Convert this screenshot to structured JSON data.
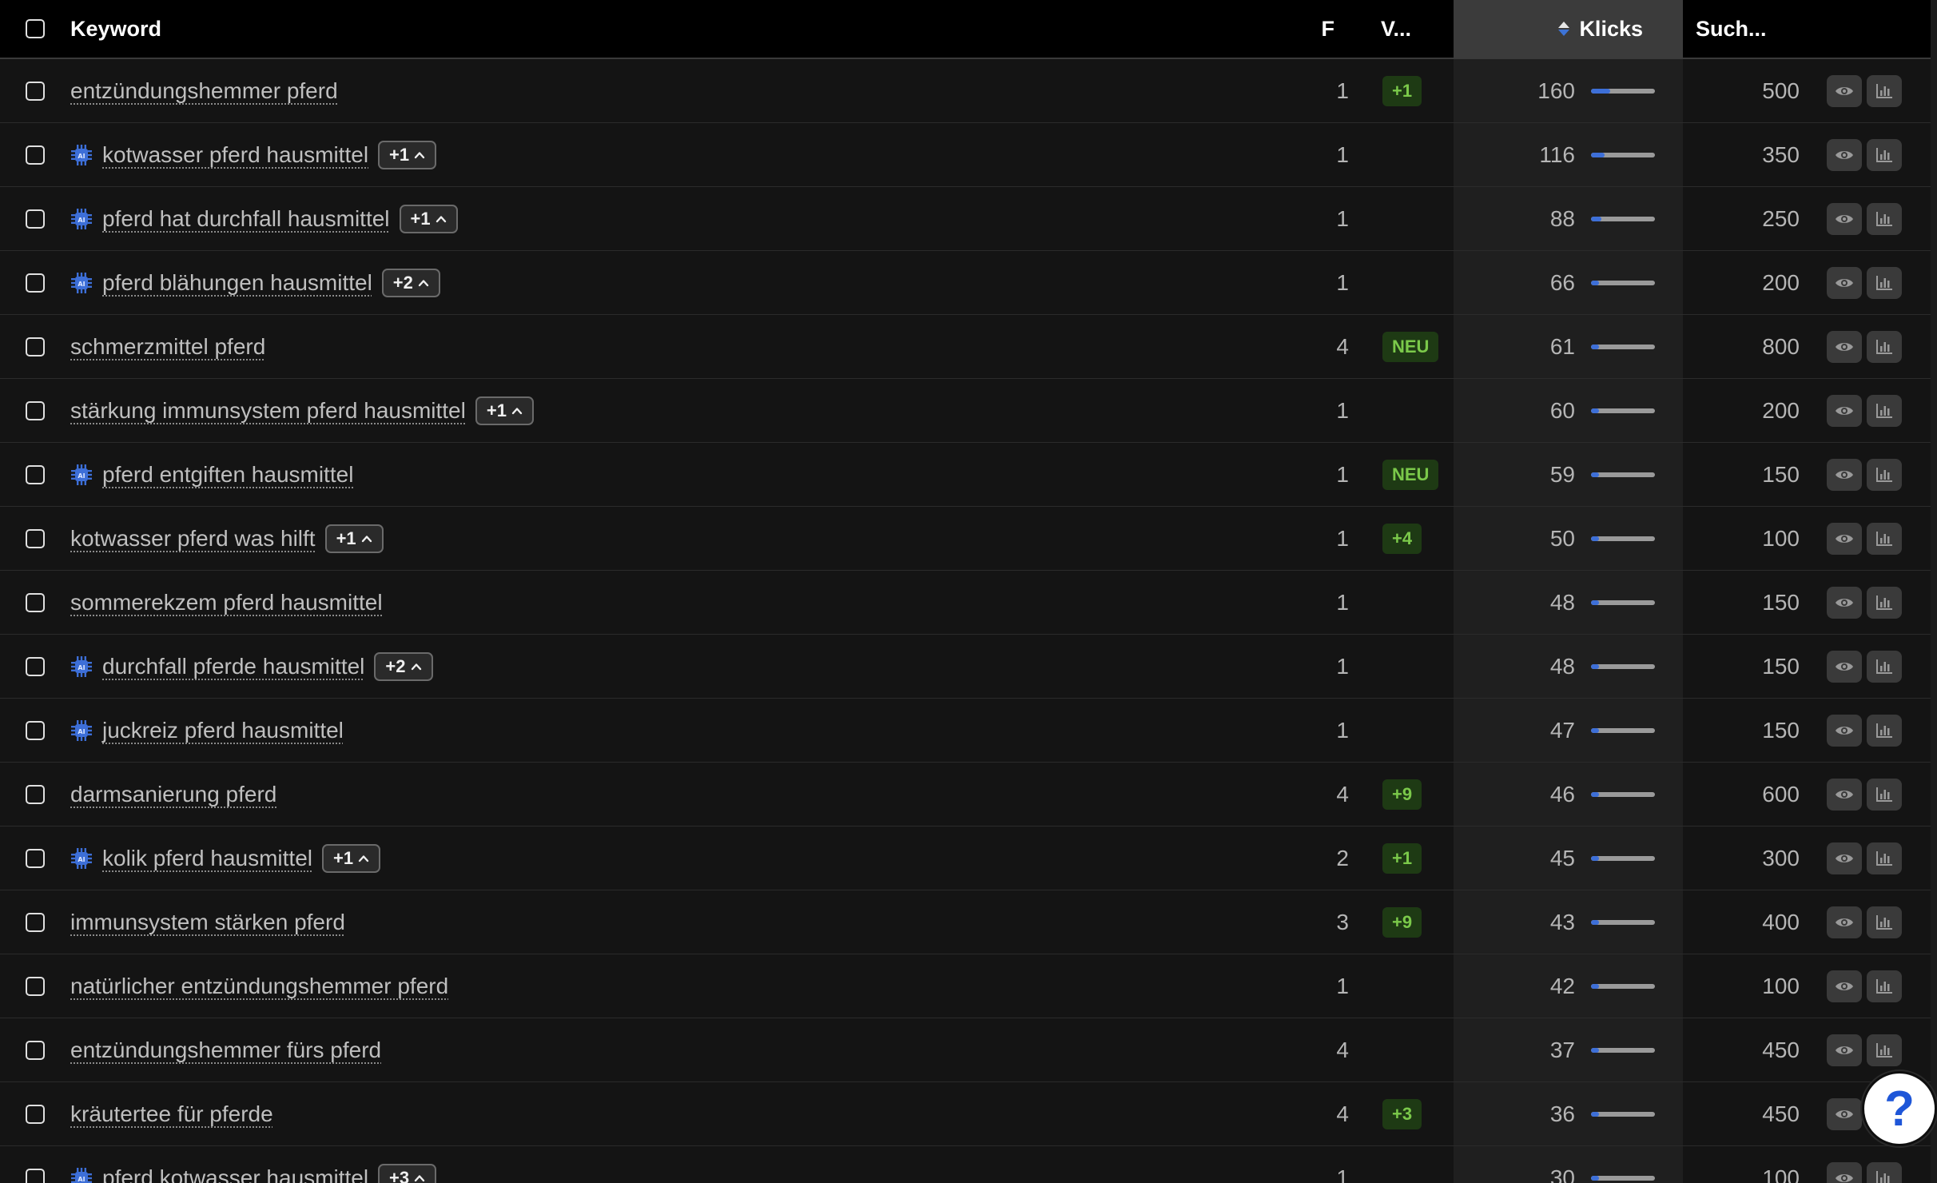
{
  "header": {
    "keyword": "Keyword",
    "f": "F",
    "v": "V...",
    "klicks": "Klicks",
    "such": "Such..."
  },
  "icons": {
    "ai": "ai-chip-icon",
    "view": "eye-icon",
    "chart": "bar-chart-icon",
    "sort": "sort-icon",
    "expand": "chevron-up-icon"
  },
  "colors": {
    "accent": "#3d6fd8",
    "positive": "#7bc94a",
    "badge_bg": "#1e3a14"
  },
  "max_klicks": 160,
  "rows": [
    {
      "keyword": "entzündungshemmer pferd",
      "ai": false,
      "plus": "",
      "f": "1",
      "v": "+1",
      "klicks": "160",
      "such": "500"
    },
    {
      "keyword": "kotwasser pferd hausmittel",
      "ai": true,
      "plus": "+1",
      "f": "1",
      "v": "",
      "klicks": "116",
      "such": "350"
    },
    {
      "keyword": "pferd hat durchfall hausmittel",
      "ai": true,
      "plus": "+1",
      "f": "1",
      "v": "",
      "klicks": "88",
      "such": "250"
    },
    {
      "keyword": "pferd blähungen hausmittel",
      "ai": true,
      "plus": "+2",
      "f": "1",
      "v": "",
      "klicks": "66",
      "such": "200"
    },
    {
      "keyword": "schmerzmittel pferd",
      "ai": false,
      "plus": "",
      "f": "4",
      "v": "NEU",
      "klicks": "61",
      "such": "800"
    },
    {
      "keyword": "stärkung immunsystem pferd hausmittel",
      "ai": false,
      "plus": "+1",
      "f": "1",
      "v": "",
      "klicks": "60",
      "such": "200"
    },
    {
      "keyword": "pferd entgiften hausmittel",
      "ai": true,
      "plus": "",
      "f": "1",
      "v": "NEU",
      "klicks": "59",
      "such": "150"
    },
    {
      "keyword": "kotwasser pferd was hilft",
      "ai": false,
      "plus": "+1",
      "f": "1",
      "v": "+4",
      "klicks": "50",
      "such": "100"
    },
    {
      "keyword": "sommerekzem pferd hausmittel",
      "ai": false,
      "plus": "",
      "f": "1",
      "v": "",
      "klicks": "48",
      "such": "150"
    },
    {
      "keyword": "durchfall pferde hausmittel",
      "ai": true,
      "plus": "+2",
      "f": "1",
      "v": "",
      "klicks": "48",
      "such": "150"
    },
    {
      "keyword": "juckreiz pferd hausmittel",
      "ai": true,
      "plus": "",
      "f": "1",
      "v": "",
      "klicks": "47",
      "such": "150"
    },
    {
      "keyword": "darmsanierung pferd",
      "ai": false,
      "plus": "",
      "f": "4",
      "v": "+9",
      "klicks": "46",
      "such": "600"
    },
    {
      "keyword": "kolik pferd hausmittel",
      "ai": true,
      "plus": "+1",
      "f": "2",
      "v": "+1",
      "klicks": "45",
      "such": "300"
    },
    {
      "keyword": "immunsystem stärken pferd",
      "ai": false,
      "plus": "",
      "f": "3",
      "v": "+9",
      "klicks": "43",
      "such": "400"
    },
    {
      "keyword": "natürlicher entzündungshemmer pferd",
      "ai": false,
      "plus": "",
      "f": "1",
      "v": "",
      "klicks": "42",
      "such": "100"
    },
    {
      "keyword": "entzündungshemmer fürs pferd",
      "ai": false,
      "plus": "",
      "f": "4",
      "v": "",
      "klicks": "37",
      "such": "450"
    },
    {
      "keyword": "kräutertee für pferde",
      "ai": false,
      "plus": "",
      "f": "4",
      "v": "+3",
      "klicks": "36",
      "such": "450"
    },
    {
      "keyword": "pferd kotwasser hausmittel",
      "ai": true,
      "plus": "+3",
      "f": "1",
      "v": "",
      "klicks": "30",
      "such": "100"
    }
  ],
  "help": {
    "label": "?"
  }
}
